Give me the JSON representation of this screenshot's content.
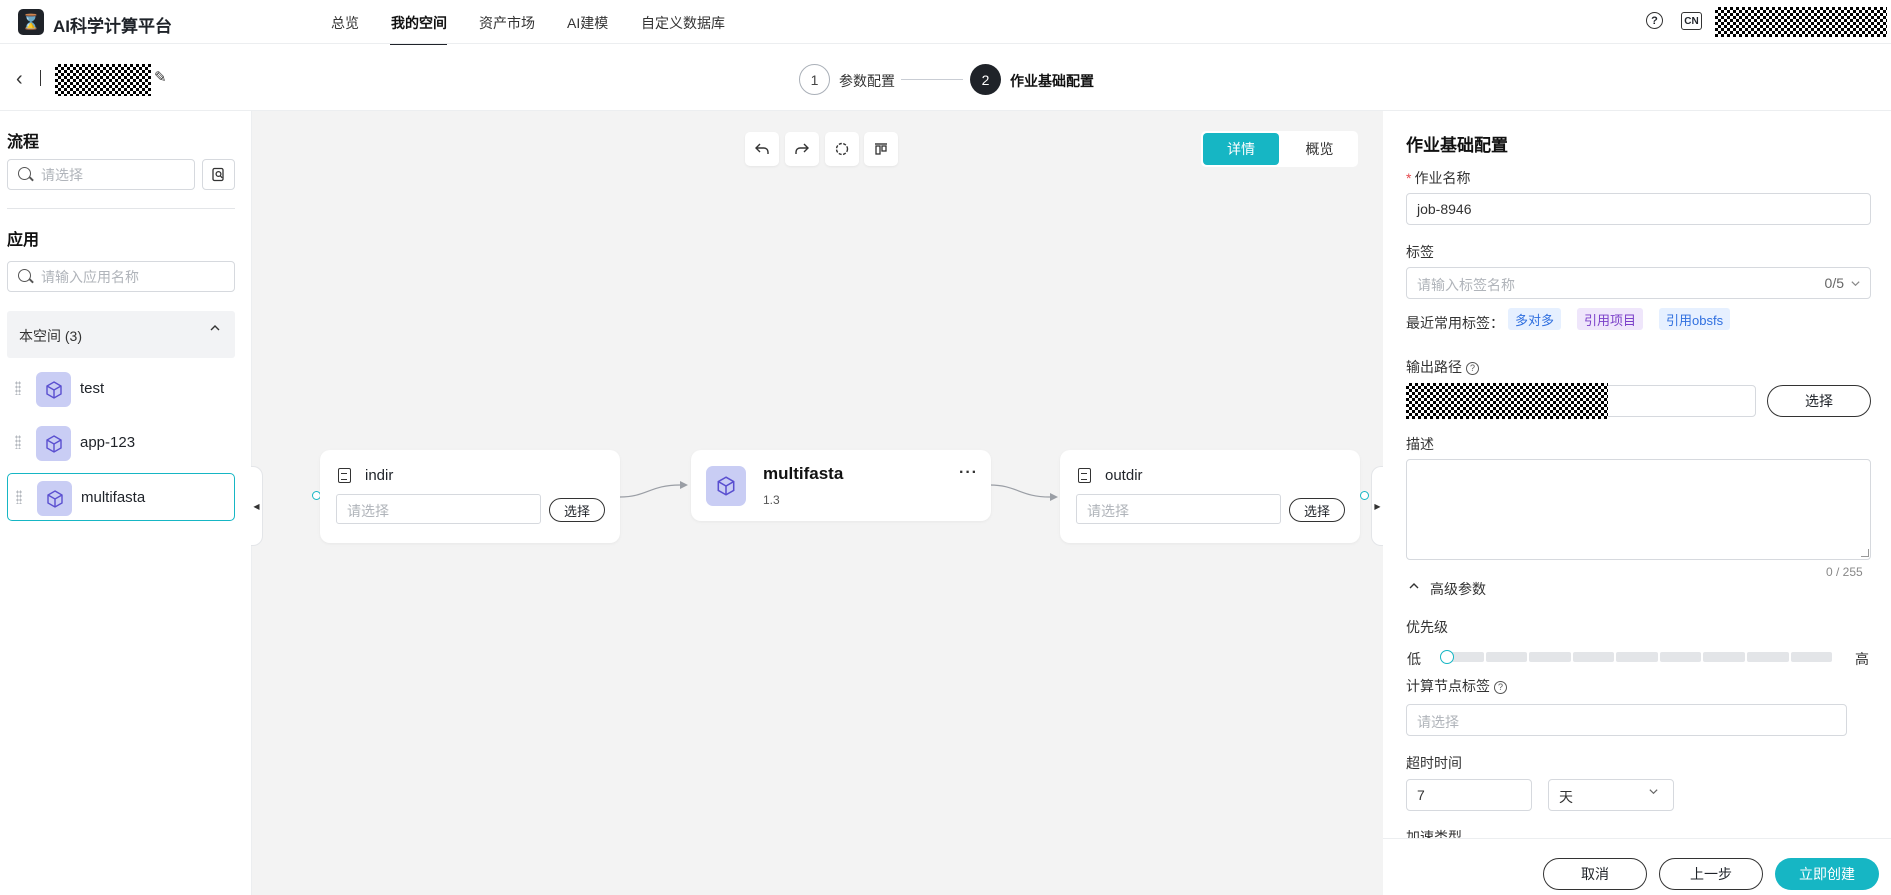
{
  "header": {
    "logo_glyph": "⌛",
    "app_title": "AI科学计算平台",
    "nav": [
      {
        "label": "总览"
      },
      {
        "label": "我的空间",
        "active": true
      },
      {
        "label": "资产市场"
      },
      {
        "label": "AI建模"
      },
      {
        "label": "自定义数据库"
      }
    ],
    "help_icon": "?",
    "lang": "CN"
  },
  "steps": [
    {
      "number": "1",
      "label": "参数配置",
      "state": "done"
    },
    {
      "number": "2",
      "label": "作业基础配置",
      "state": "current"
    }
  ],
  "left_panel": {
    "flow_title": "流程",
    "flow_search_placeholder": "请选择",
    "app_title": "应用",
    "app_search_placeholder": "请输入应用名称",
    "group_label": "本空间 (3)",
    "apps": [
      {
        "name": "test"
      },
      {
        "name": "app-123"
      },
      {
        "name": "multifasta",
        "selected": true
      }
    ]
  },
  "canvas": {
    "view_detail": "详情",
    "view_overview": "概览",
    "input_node": {
      "title": "indir",
      "placeholder": "请选择",
      "button": "选择"
    },
    "app_node": {
      "title": "multifasta",
      "version": "1.3",
      "menu": "···"
    },
    "output_node": {
      "title": "outdir",
      "placeholder": "请选择",
      "button": "选择"
    }
  },
  "form": {
    "title": "作业基础配置",
    "job_name_label": "作业名称",
    "job_name_value": "job-8946",
    "tags_label": "标签",
    "tags_placeholder": "请输入标签名称",
    "tags_count": "0/5",
    "recent_tags_label": "最近常用标签：",
    "recent_tags": [
      {
        "label": "多对多",
        "bg": "#e6f0ff",
        "fg": "#2f6fdf"
      },
      {
        "label": "引用项目",
        "bg": "#efe6fb",
        "fg": "#7b3fc9"
      },
      {
        "label": "引用obsfs",
        "bg": "#e6f0ff",
        "fg": "#2f6fdf"
      }
    ],
    "output_path_label": "输出路径",
    "output_select_button": "选择",
    "description_label": "描述",
    "description_count": "0 / 255",
    "advanced_label": "高级参数",
    "priority_label": "优先级",
    "priority_low": "低",
    "priority_high": "高",
    "priority_level": 0,
    "node_tag_label": "计算节点标签",
    "node_tag_placeholder": "请选择",
    "timeout_label": "超时时间",
    "timeout_value": "7",
    "timeout_unit": "天",
    "accel_label": "加速类型"
  },
  "footer": {
    "cancel": "取消",
    "previous": "上一步",
    "create": "立即创建"
  },
  "colors": {
    "accent": "#16b6c4",
    "app_icon_bg": "#c9cdf4"
  }
}
